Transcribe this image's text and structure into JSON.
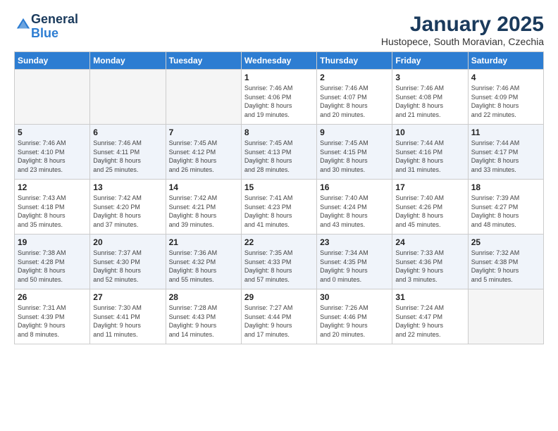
{
  "header": {
    "logo_general": "General",
    "logo_blue": "Blue",
    "month": "January 2025",
    "location": "Hustopece, South Moravian, Czechia"
  },
  "weekdays": [
    "Sunday",
    "Monday",
    "Tuesday",
    "Wednesday",
    "Thursday",
    "Friday",
    "Saturday"
  ],
  "weeks": [
    [
      {
        "day": "",
        "info": ""
      },
      {
        "day": "",
        "info": ""
      },
      {
        "day": "",
        "info": ""
      },
      {
        "day": "1",
        "info": "Sunrise: 7:46 AM\nSunset: 4:06 PM\nDaylight: 8 hours\nand 19 minutes."
      },
      {
        "day": "2",
        "info": "Sunrise: 7:46 AM\nSunset: 4:07 PM\nDaylight: 8 hours\nand 20 minutes."
      },
      {
        "day": "3",
        "info": "Sunrise: 7:46 AM\nSunset: 4:08 PM\nDaylight: 8 hours\nand 21 minutes."
      },
      {
        "day": "4",
        "info": "Sunrise: 7:46 AM\nSunset: 4:09 PM\nDaylight: 8 hours\nand 22 minutes."
      }
    ],
    [
      {
        "day": "5",
        "info": "Sunrise: 7:46 AM\nSunset: 4:10 PM\nDaylight: 8 hours\nand 23 minutes."
      },
      {
        "day": "6",
        "info": "Sunrise: 7:46 AM\nSunset: 4:11 PM\nDaylight: 8 hours\nand 25 minutes."
      },
      {
        "day": "7",
        "info": "Sunrise: 7:45 AM\nSunset: 4:12 PM\nDaylight: 8 hours\nand 26 minutes."
      },
      {
        "day": "8",
        "info": "Sunrise: 7:45 AM\nSunset: 4:13 PM\nDaylight: 8 hours\nand 28 minutes."
      },
      {
        "day": "9",
        "info": "Sunrise: 7:45 AM\nSunset: 4:15 PM\nDaylight: 8 hours\nand 30 minutes."
      },
      {
        "day": "10",
        "info": "Sunrise: 7:44 AM\nSunset: 4:16 PM\nDaylight: 8 hours\nand 31 minutes."
      },
      {
        "day": "11",
        "info": "Sunrise: 7:44 AM\nSunset: 4:17 PM\nDaylight: 8 hours\nand 33 minutes."
      }
    ],
    [
      {
        "day": "12",
        "info": "Sunrise: 7:43 AM\nSunset: 4:18 PM\nDaylight: 8 hours\nand 35 minutes."
      },
      {
        "day": "13",
        "info": "Sunrise: 7:42 AM\nSunset: 4:20 PM\nDaylight: 8 hours\nand 37 minutes."
      },
      {
        "day": "14",
        "info": "Sunrise: 7:42 AM\nSunset: 4:21 PM\nDaylight: 8 hours\nand 39 minutes."
      },
      {
        "day": "15",
        "info": "Sunrise: 7:41 AM\nSunset: 4:23 PM\nDaylight: 8 hours\nand 41 minutes."
      },
      {
        "day": "16",
        "info": "Sunrise: 7:40 AM\nSunset: 4:24 PM\nDaylight: 8 hours\nand 43 minutes."
      },
      {
        "day": "17",
        "info": "Sunrise: 7:40 AM\nSunset: 4:26 PM\nDaylight: 8 hours\nand 45 minutes."
      },
      {
        "day": "18",
        "info": "Sunrise: 7:39 AM\nSunset: 4:27 PM\nDaylight: 8 hours\nand 48 minutes."
      }
    ],
    [
      {
        "day": "19",
        "info": "Sunrise: 7:38 AM\nSunset: 4:28 PM\nDaylight: 8 hours\nand 50 minutes."
      },
      {
        "day": "20",
        "info": "Sunrise: 7:37 AM\nSunset: 4:30 PM\nDaylight: 8 hours\nand 52 minutes."
      },
      {
        "day": "21",
        "info": "Sunrise: 7:36 AM\nSunset: 4:32 PM\nDaylight: 8 hours\nand 55 minutes."
      },
      {
        "day": "22",
        "info": "Sunrise: 7:35 AM\nSunset: 4:33 PM\nDaylight: 8 hours\nand 57 minutes."
      },
      {
        "day": "23",
        "info": "Sunrise: 7:34 AM\nSunset: 4:35 PM\nDaylight: 9 hours\nand 0 minutes."
      },
      {
        "day": "24",
        "info": "Sunrise: 7:33 AM\nSunset: 4:36 PM\nDaylight: 9 hours\nand 3 minutes."
      },
      {
        "day": "25",
        "info": "Sunrise: 7:32 AM\nSunset: 4:38 PM\nDaylight: 9 hours\nand 5 minutes."
      }
    ],
    [
      {
        "day": "26",
        "info": "Sunrise: 7:31 AM\nSunset: 4:39 PM\nDaylight: 9 hours\nand 8 minutes."
      },
      {
        "day": "27",
        "info": "Sunrise: 7:30 AM\nSunset: 4:41 PM\nDaylight: 9 hours\nand 11 minutes."
      },
      {
        "day": "28",
        "info": "Sunrise: 7:28 AM\nSunset: 4:43 PM\nDaylight: 9 hours\nand 14 minutes."
      },
      {
        "day": "29",
        "info": "Sunrise: 7:27 AM\nSunset: 4:44 PM\nDaylight: 9 hours\nand 17 minutes."
      },
      {
        "day": "30",
        "info": "Sunrise: 7:26 AM\nSunset: 4:46 PM\nDaylight: 9 hours\nand 20 minutes."
      },
      {
        "day": "31",
        "info": "Sunrise: 7:24 AM\nSunset: 4:47 PM\nDaylight: 9 hours\nand 22 minutes."
      },
      {
        "day": "",
        "info": ""
      }
    ]
  ]
}
